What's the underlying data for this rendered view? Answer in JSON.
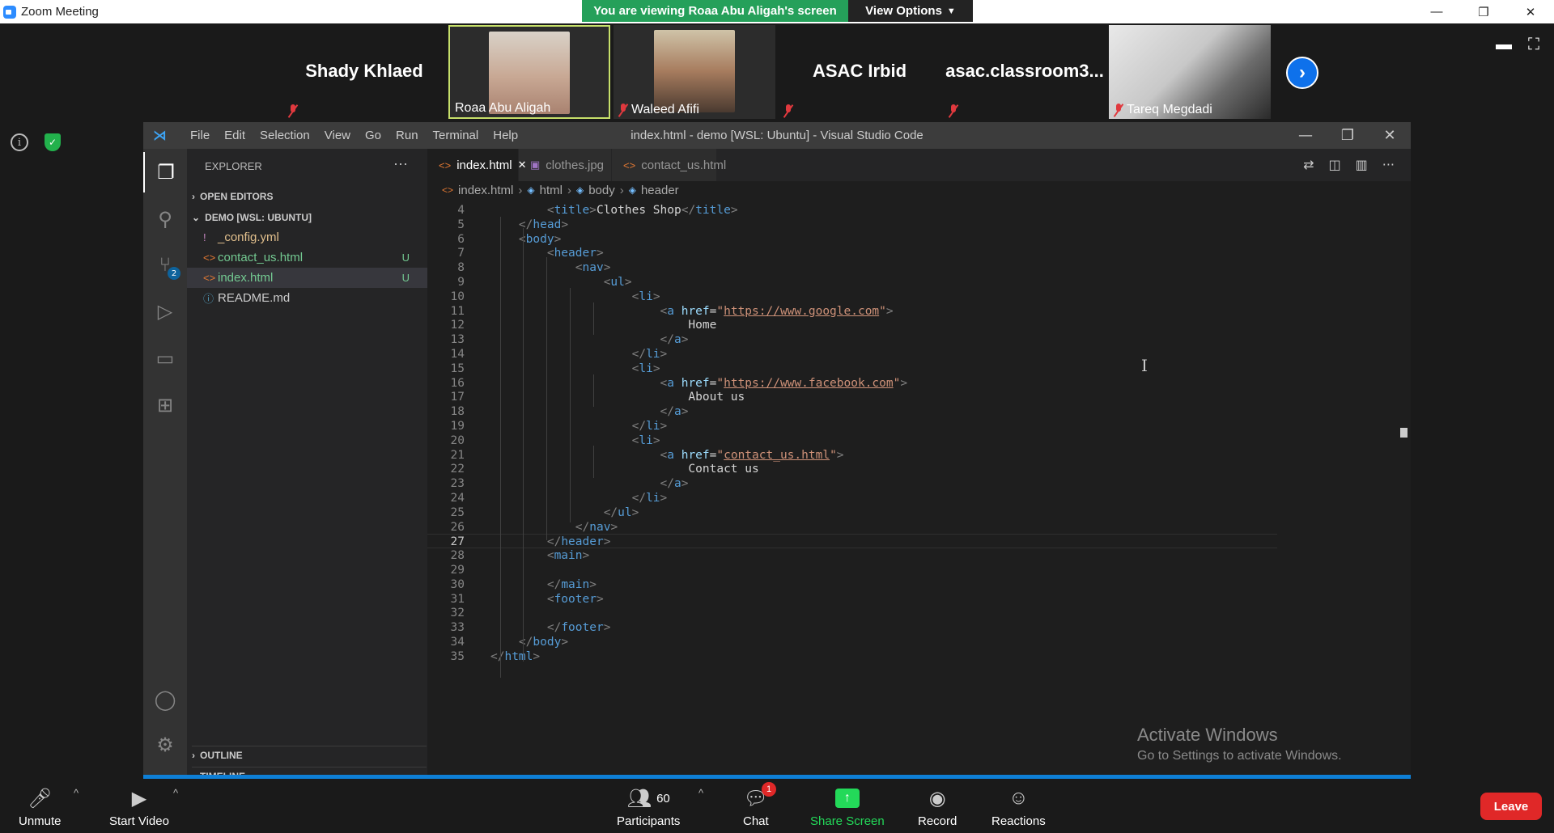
{
  "zoom": {
    "window_title": "Zoom Meeting",
    "banner": "You are viewing Roaa Abu Aligah's screen",
    "view_options": "View Options"
  },
  "participants": [
    {
      "name": "Shady Khlaed",
      "muted": true,
      "video": false
    },
    {
      "name": "Roaa Abu Aligah",
      "muted": false,
      "video": true,
      "active": true
    },
    {
      "name": "Waleed Afifi",
      "muted": true,
      "video": true
    },
    {
      "name": "ASAC Irbid",
      "muted": true,
      "video": false
    },
    {
      "name": "asac.classroom3...",
      "muted": true,
      "video": false
    },
    {
      "name": "Tareq Megdadi",
      "muted": true,
      "video": true
    }
  ],
  "vscode": {
    "menu": [
      "File",
      "Edit",
      "Selection",
      "View",
      "Go",
      "Run",
      "Terminal",
      "Help"
    ],
    "title": "index.html - demo [WSL: Ubuntu] - Visual Studio Code",
    "explorer_label": "EXPLORER",
    "open_editors_label": "OPEN EDITORS",
    "workspace_label": "DEMO [WSL: UBUNTU]",
    "files": [
      {
        "name": "_config.yml",
        "icon": "!",
        "color": "#e2c08d",
        "badge": ""
      },
      {
        "name": "contact_us.html",
        "icon": "<>",
        "color": "#73c991",
        "badge": "U"
      },
      {
        "name": "index.html",
        "icon": "<>",
        "color": "#73c991",
        "badge": "U",
        "selected": true
      },
      {
        "name": "README.md",
        "icon": "ⓘ",
        "color": "#cccccc",
        "badge": ""
      }
    ],
    "outline_label": "OUTLINE",
    "timeline_label": "TIMELINE",
    "scm_badge": "2",
    "tabs": [
      {
        "label": "index.html",
        "active": true
      },
      {
        "label": "clothes.jpg",
        "active": false
      },
      {
        "label": "contact_us.html",
        "active": false
      }
    ],
    "breadcrumb": [
      "index.html",
      "html",
      "body",
      "header"
    ],
    "code": [
      {
        "n": "4",
        "text": "        <title>Clothes Shop</title>"
      },
      {
        "n": "5",
        "text": "    </head>"
      },
      {
        "n": "6",
        "text": "    <body>"
      },
      {
        "n": "7",
        "text": "        <header>"
      },
      {
        "n": "8",
        "text": "            <nav>"
      },
      {
        "n": "9",
        "text": "                <ul>"
      },
      {
        "n": "10",
        "text": "                    <li>"
      },
      {
        "n": "11",
        "text": "                        <a href=\"https://www.google.com\">"
      },
      {
        "n": "12",
        "text": "                            Home"
      },
      {
        "n": "13",
        "text": "                        </a>"
      },
      {
        "n": "14",
        "text": "                    </li>"
      },
      {
        "n": "15",
        "text": "                    <li>"
      },
      {
        "n": "16",
        "text": "                        <a href=\"https://www.facebook.com\">"
      },
      {
        "n": "17",
        "text": "                            About us"
      },
      {
        "n": "18",
        "text": "                        </a>"
      },
      {
        "n": "19",
        "text": "                    </li>"
      },
      {
        "n": "20",
        "text": "                    <li>"
      },
      {
        "n": "21",
        "text": "                        <a href=\"contact_us.html\">"
      },
      {
        "n": "22",
        "text": "                            Contact us"
      },
      {
        "n": "23",
        "text": "                        </a>"
      },
      {
        "n": "24",
        "text": "                    </li>"
      },
      {
        "n": "25",
        "text": "                </ul>"
      },
      {
        "n": "26",
        "text": "            </nav>"
      },
      {
        "n": "27",
        "text": "        </header>",
        "current": true
      },
      {
        "n": "28",
        "text": "        <main>"
      },
      {
        "n": "29",
        "text": ""
      },
      {
        "n": "30",
        "text": "        </main>"
      },
      {
        "n": "31",
        "text": "        <footer>"
      },
      {
        "n": "32",
        "text": ""
      },
      {
        "n": "33",
        "text": "        </footer>"
      },
      {
        "n": "34",
        "text": "    </body>"
      },
      {
        "n": "35",
        "text": "</html>"
      }
    ]
  },
  "watermark": {
    "line1": "Activate Windows",
    "line2": "Go to Settings to activate Windows."
  },
  "toolbar": {
    "unmute": "Unmute",
    "start_video": "Start Video",
    "participants": "Participants",
    "participants_count": "60",
    "chat": "Chat",
    "chat_badge": "1",
    "share_screen": "Share Screen",
    "record": "Record",
    "reactions": "Reactions",
    "leave": "Leave"
  },
  "colors": {
    "banner_green": "#25a05a",
    "leave_red": "#e02828",
    "vscode_accent": "#0e7fd6",
    "untracked_green": "#73c991"
  }
}
